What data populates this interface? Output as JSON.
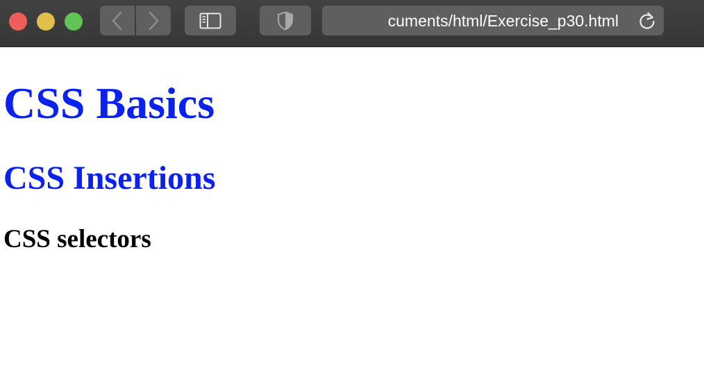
{
  "browser": {
    "address_bar": {
      "url_text": "cuments/html/Exercise_p30.html"
    },
    "traffic_lights": {
      "close_color": "#ee5f59",
      "minimize_color": "#e1bf4d",
      "zoom_color": "#61c454"
    },
    "icons": {
      "back": "chevron-left-icon",
      "forward": "chevron-right-icon",
      "sidebar": "sidebar-icon",
      "privacy": "shield-icon",
      "reload": "reload-icon"
    }
  },
  "page": {
    "heading_1": "CSS Basics",
    "heading_2": "CSS Insertions",
    "heading_3": "CSS selectors",
    "colors": {
      "heading_1": "#0a21ef",
      "heading_2": "#0a21ef",
      "heading_3": "#000000",
      "background": "#ffffff"
    }
  }
}
